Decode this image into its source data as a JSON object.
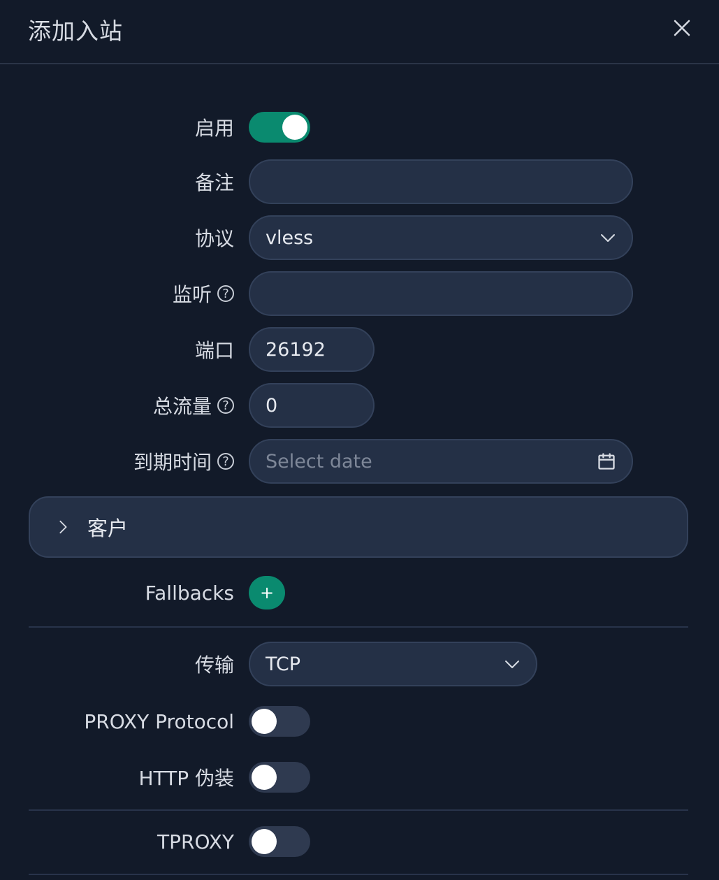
{
  "dialog": {
    "title": "添加入站",
    "close_icon": "close-icon"
  },
  "form": {
    "enable": {
      "label": "启用",
      "value": true
    },
    "remark": {
      "label": "备注",
      "value": ""
    },
    "protocol": {
      "label": "协议",
      "value": "vless"
    },
    "listen": {
      "label": "监听",
      "value": "",
      "help_icon": "question-circle-icon"
    },
    "port": {
      "label": "端口",
      "value": "26192"
    },
    "total_traffic": {
      "label": "总流量",
      "value": "0",
      "help_icon": "question-circle-icon"
    },
    "expiry": {
      "label": "到期时间",
      "placeholder": "Select date",
      "help_icon": "question-circle-icon",
      "icon": "calendar-icon"
    },
    "clients": {
      "label": "客户"
    },
    "fallbacks": {
      "label": "Fallbacks",
      "add_label": "+"
    },
    "transport": {
      "label": "传输",
      "value": "TCP"
    },
    "proxy_protocol": {
      "label": "PROXY Protocol",
      "value": false
    },
    "http_camouflage": {
      "label": "HTTP 伪装",
      "value": false
    },
    "tproxy": {
      "label": "TPROXY",
      "value": false
    }
  },
  "colors": {
    "background": "#121a29",
    "field_bg": "#243046",
    "accent": "#0a8a6f",
    "toggle_off": "#2f3a50"
  }
}
